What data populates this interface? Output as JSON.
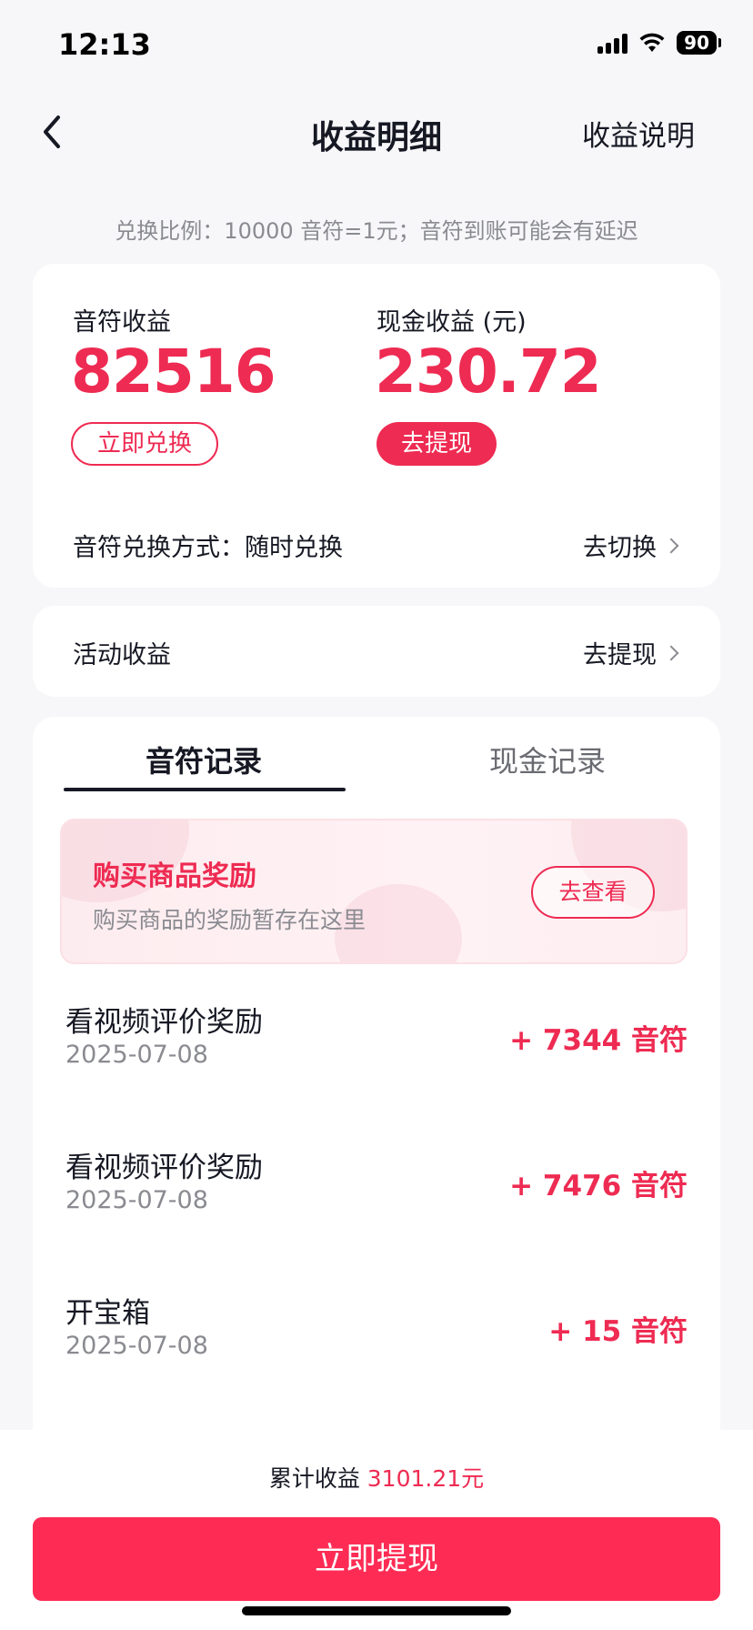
{
  "status_bar": {
    "time": "12:13",
    "battery": "90"
  },
  "nav": {
    "title": "收益明细",
    "right_link": "收益说明"
  },
  "rate_note": "兑换比例：10000 音符=1元；音符到账可能会有延迟",
  "earnings": {
    "notes_label": "音符收益",
    "notes_value": "82516",
    "notes_button": "立即兑换",
    "cash_label": "现金收益 (元)",
    "cash_value": "230.72",
    "cash_button": "去提现",
    "exchange_mode_label": "音符兑换方式：随时兑换",
    "exchange_mode_link": "去切换"
  },
  "activity": {
    "label": "活动收益",
    "link": "去提现"
  },
  "tabs": [
    {
      "label": "音符记录",
      "active": true
    },
    {
      "label": "现金记录",
      "active": false
    }
  ],
  "promo": {
    "title": "购买商品奖励",
    "subtitle": "购买商品的奖励暂存在这里",
    "button": "去查看"
  },
  "records": [
    {
      "title": "看视频评价奖励",
      "date": "2025-07-08",
      "amount": "+ 7344 音符"
    },
    {
      "title": "看视频评价奖励",
      "date": "2025-07-08",
      "amount": "+ 7476 音符"
    },
    {
      "title": "开宝箱",
      "date": "2025-07-08",
      "amount": "+ 15 音符"
    }
  ],
  "footer": {
    "total_label": "累计收益",
    "total_amount": "3101.21元",
    "withdraw_button": "立即提现"
  },
  "colors": {
    "accent": "#ee2b52",
    "button": "#fe2c55",
    "background": "#f7f7f9"
  }
}
